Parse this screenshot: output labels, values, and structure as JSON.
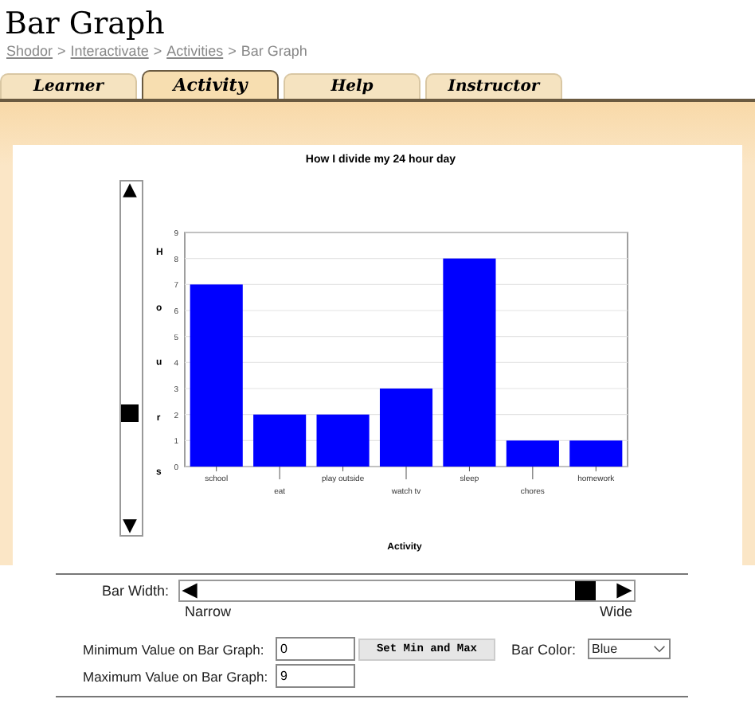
{
  "page": {
    "title": "Bar Graph",
    "breadcrumb": {
      "separator": ">",
      "items": [
        {
          "label": "Shodor",
          "link": true
        },
        {
          "label": "Interactivate",
          "link": true
        },
        {
          "label": "Activities",
          "link": true
        },
        {
          "label": "Bar Graph",
          "link": false
        }
      ]
    }
  },
  "tabs": [
    {
      "label": "Learner",
      "selected": false
    },
    {
      "label": "Activity",
      "selected": true
    },
    {
      "label": "Help",
      "selected": false
    },
    {
      "label": "Instructor",
      "selected": false
    }
  ],
  "graph": {
    "vertical_slider": {
      "level": 0.32
    },
    "chart_data": {
      "type": "bar",
      "title": "How I divide my 24 hour day",
      "xlabel": "Activity",
      "ylabel": "Hours",
      "categories": [
        "school",
        "eat",
        "play outside",
        "watch tv",
        "sleep",
        "chores",
        "homework"
      ],
      "series": [
        {
          "color": "#0000ff",
          "values": [
            7,
            2,
            2,
            3,
            8,
            1,
            1
          ]
        }
      ],
      "grid": true,
      "ylim": [
        0,
        9
      ],
      "yticks": [
        0,
        1,
        2,
        3,
        4,
        5,
        6,
        7,
        8,
        9
      ]
    }
  },
  "controls": {
    "bar_width": {
      "label": "Bar Width:",
      "level": 0.95,
      "min_label": "Narrow",
      "max_label": "Wide"
    },
    "min_value": {
      "label": "Minimum Value on Bar Graph:",
      "value": "0"
    },
    "set_button": "Set Min and Max",
    "bar_color": {
      "label": "Bar Color:",
      "value": "Blue"
    },
    "max_value": {
      "label": "Maximum Value on Bar Graph:",
      "value": "9"
    }
  }
}
